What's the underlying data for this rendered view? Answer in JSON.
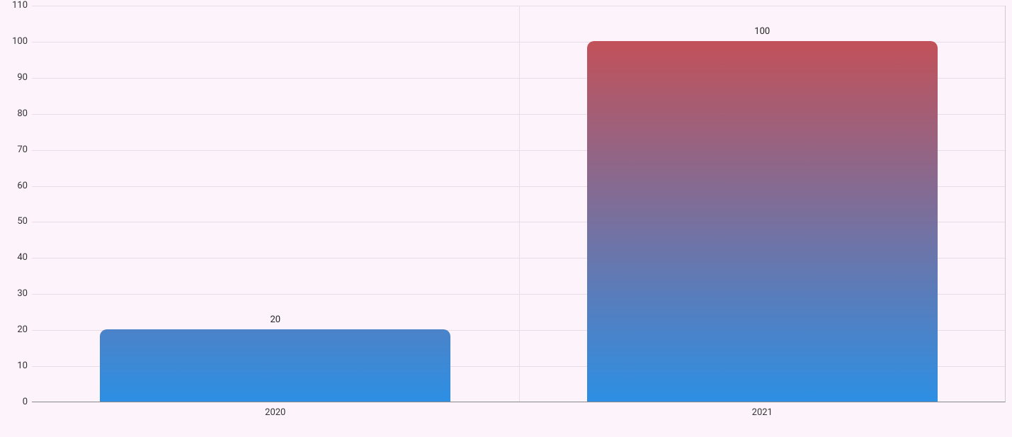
{
  "chart_data": {
    "type": "bar",
    "categories": [
      "2020",
      "2021"
    ],
    "values": [
      20,
      100
    ],
    "title": "",
    "xlabel": "",
    "ylabel": "",
    "ylim": [
      0,
      110
    ],
    "yticks": [
      0,
      10,
      20,
      30,
      40,
      50,
      60,
      70,
      80,
      90,
      100,
      110
    ],
    "colors": {
      "gradient_top": "#d14b4b",
      "gradient_bottom": "#2d8fe4",
      "background": "#fdf4fb",
      "grid": "#e9dce8"
    }
  }
}
